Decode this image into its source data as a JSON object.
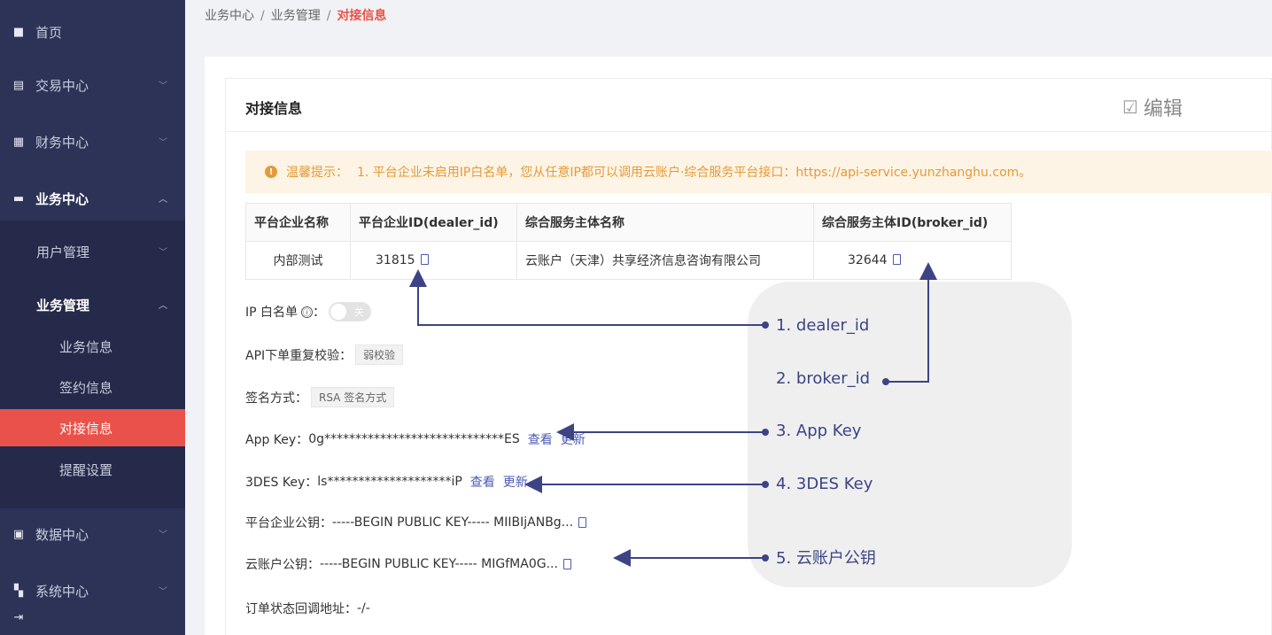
{
  "sidebar": {
    "items": [
      {
        "label": "首页",
        "icon": "home-icon"
      },
      {
        "label": "交易中心",
        "icon": "ledger-icon"
      },
      {
        "label": "财务中心",
        "icon": "finance-icon"
      },
      {
        "label": "业务中心",
        "icon": "briefcase-icon"
      },
      {
        "label": "数据中心",
        "icon": "chart-icon"
      },
      {
        "label": "系统中心",
        "icon": "grid-icon"
      }
    ],
    "business_sub": {
      "user_mgmt": "用户管理",
      "biz_mgmt": "业务管理",
      "biz_info": "业务信息",
      "sign_info": "签约信息",
      "dock_info": "对接信息",
      "reminder": "提醒设置"
    }
  },
  "breadcrumb": {
    "level1": "业务中心",
    "level2": "业务管理",
    "current": "对接信息",
    "separator": "/"
  },
  "card": {
    "title": "对接信息",
    "edit_label": "编辑"
  },
  "notice": {
    "label": "温馨提示：",
    "text": "1. 平台企业未启用IP白名单，您从任意IP都可以调用云账户·综合服务平台接口：https://api-service.yunzhanghu.com。"
  },
  "table": {
    "headers": [
      "平台企业名称",
      "平台企业ID(dealer_id)",
      "综合服务主体名称",
      "综合服务主体ID(broker_id)"
    ],
    "row": [
      "内部测试",
      "31815",
      "云账户（天津）共享经济信息咨询有限公司",
      "32644"
    ]
  },
  "fields": {
    "ip_whitelist_label": "IP 白名单",
    "ip_whitelist_info": "ⓘ",
    "ip_whitelist_colon": "：",
    "ip_toggle_text": "关",
    "api_check_label": "API下单重复校验：",
    "api_check_value": "弱校验",
    "sign_label": "签名方式：",
    "sign_value": "RSA 签名方式",
    "app_key_label": "App Key：",
    "app_key_value": "0g*****************************ES",
    "des_key_label": "3DES Key：",
    "des_key_value": "ls********************iP",
    "view": "查看",
    "refresh": "更新",
    "dealer_pubkey_label": "平台企业公钥：",
    "dealer_pubkey_value": "-----BEGIN PUBLIC KEY----- MIIBIjANBg...",
    "yzh_pubkey_label": "云账户公钥：",
    "yzh_pubkey_value": "-----BEGIN PUBLIC KEY----- MIGfMA0G...",
    "callback_label": "订单状态回调地址：",
    "callback_value": "-/-"
  },
  "annotations": [
    "1. dealer_id",
    "2. broker_id",
    "3. App Key",
    "4. 3DES Key",
    "5. 云账户公钥"
  ],
  "colors": {
    "sidebar_bg": "#2d3357",
    "active_red": "#e9524a",
    "link_blue": "#4a5bb5",
    "notice_orange": "#e59a3a",
    "annotation_ink": "#3d4384"
  }
}
